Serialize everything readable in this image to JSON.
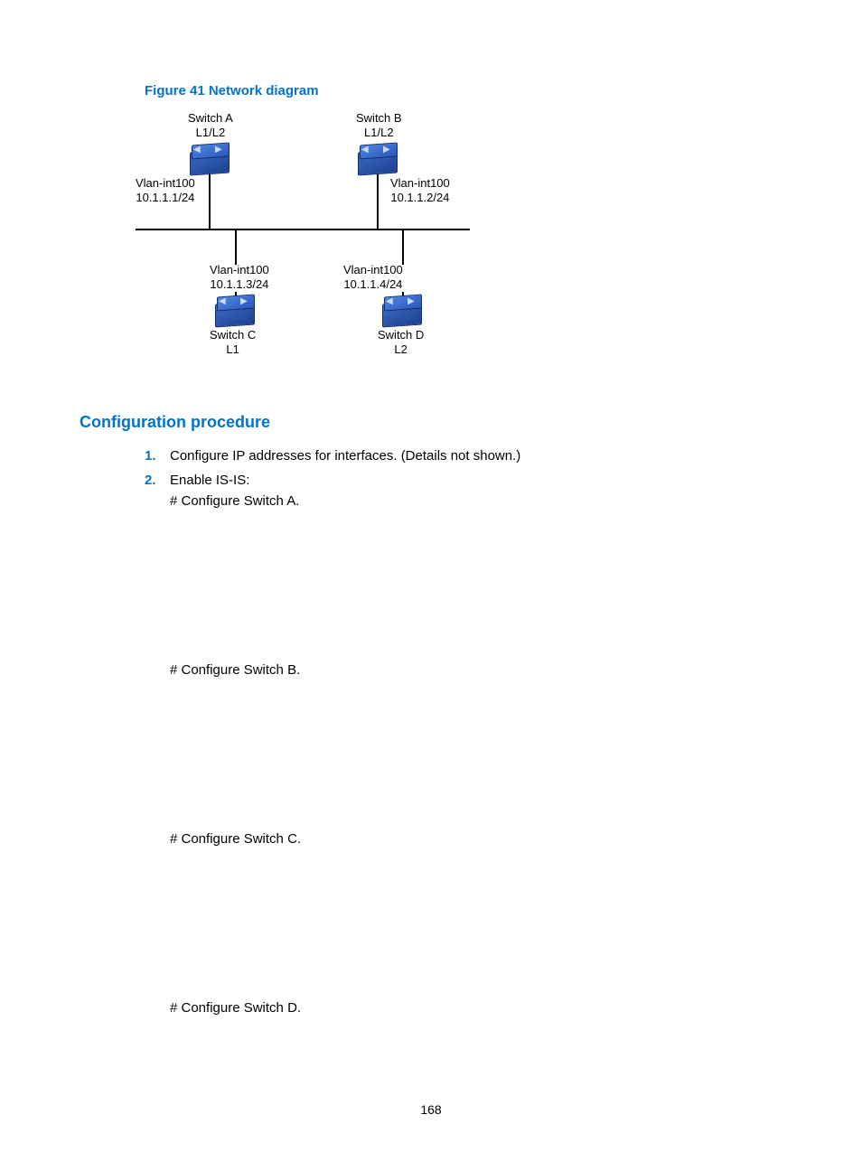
{
  "figure": {
    "title": "Figure 41 Network diagram",
    "nodes": {
      "a": {
        "name": "Switch A",
        "level": "L1/L2",
        "if": "Vlan-int100",
        "ip": "10.1.1.1/24"
      },
      "b": {
        "name": "Switch B",
        "level": "L1/L2",
        "if": "Vlan-int100",
        "ip": "10.1.1.2/24"
      },
      "c": {
        "name": "Switch C",
        "level": "L1",
        "if": "Vlan-int100",
        "ip": "10.1.1.3/24"
      },
      "d": {
        "name": "Switch D",
        "level": "L2",
        "if": "Vlan-int100",
        "ip": "10.1.1.4/24"
      }
    }
  },
  "section": {
    "heading": "Configuration procedure"
  },
  "steps": [
    {
      "num": "1.",
      "text": "Configure IP addresses for interfaces. (Details not shown.)"
    },
    {
      "num": "2.",
      "text": "Enable IS-IS:",
      "sub": "# Configure Switch A."
    }
  ],
  "config": {
    "b": "# Configure Switch B.",
    "c": "# Configure Switch C.",
    "d": "# Configure Switch D."
  },
  "page_number": "168"
}
